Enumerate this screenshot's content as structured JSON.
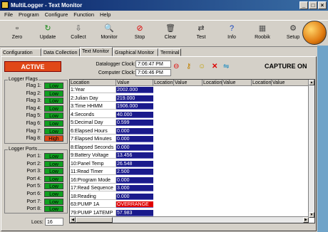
{
  "window": {
    "title": "MultiLogger - Text Monitor"
  },
  "menu": [
    "File",
    "Program",
    "Configure",
    "Function",
    "Help"
  ],
  "toolbar": [
    {
      "label": "Zero",
      "icon": "zero-icon",
      "glyph": "▫",
      "color": "#000"
    },
    {
      "label": "Update",
      "icon": "update-icon",
      "glyph": "↻",
      "color": "#1a8a1a"
    },
    {
      "label": "Collect",
      "icon": "collect-icon",
      "glyph": "⇩",
      "color": "#555"
    },
    {
      "label": "Monitor",
      "icon": "monitor-icon",
      "glyph": "🔍",
      "color": "#333"
    },
    {
      "label": "Stop",
      "icon": "stop-icon",
      "glyph": "⊘",
      "color": "#d00"
    },
    {
      "label": "Clear",
      "icon": "clear-icon",
      "glyph": "🗑",
      "color": "#333"
    },
    {
      "label": "Test",
      "icon": "test-icon",
      "glyph": "⇄",
      "color": "#333"
    },
    {
      "label": "Info",
      "icon": "info-icon",
      "glyph": "?",
      "color": "#1040c0"
    },
    {
      "label": "Roobik",
      "icon": "roobik-icon",
      "glyph": "▦",
      "color": "#555"
    },
    {
      "label": "Setup",
      "icon": "setup-icon",
      "glyph": "⚙",
      "color": "#333"
    }
  ],
  "tabs": [
    "Configuration",
    "Data Collection",
    "Text Monitor",
    "Graphical Monitor",
    "Terminal"
  ],
  "active_tab": "Text Monitor",
  "status": {
    "active": "ACTIVE",
    "capture": "CAPTURE ON"
  },
  "clocks": {
    "datalogger_label": "Datalogger Clock:",
    "datalogger_value": "7:06:47 PM",
    "computer_label": "Computer Clock:",
    "computer_value": "7:06:46 PM"
  },
  "logger_flags": {
    "title": "Logger Flags",
    "items": [
      {
        "label": "Flag 1:",
        "state": "Low"
      },
      {
        "label": "Flag 2:",
        "state": "Low"
      },
      {
        "label": "Flag 3:",
        "state": "Low"
      },
      {
        "label": "Flag 4:",
        "state": "Low"
      },
      {
        "label": "Flag 5:",
        "state": "Low"
      },
      {
        "label": "Flag 6:",
        "state": "Low"
      },
      {
        "label": "Flag 7:",
        "state": "Low"
      },
      {
        "label": "Flag 8:",
        "state": "High"
      }
    ]
  },
  "logger_ports": {
    "title": "Logger Ports",
    "items": [
      {
        "label": "Port 1:",
        "state": "Low"
      },
      {
        "label": "Port 2:",
        "state": "Low"
      },
      {
        "label": "Port 3:",
        "state": "Low"
      },
      {
        "label": "Port 4:",
        "state": "Low"
      },
      {
        "label": "Port 5:",
        "state": "Low"
      },
      {
        "label": "Port 6:",
        "state": "Low"
      },
      {
        "label": "Port 7:",
        "state": "Low"
      },
      {
        "label": "Port 8:",
        "state": "Low"
      }
    ]
  },
  "locs": {
    "label": "Locs:",
    "value": "16"
  },
  "grid": {
    "headers": [
      "Location",
      "Value",
      "Location",
      "Value",
      "Location",
      "Value",
      "Location",
      "Value"
    ],
    "rows": [
      {
        "location": "1:Year",
        "value": "2002.000"
      },
      {
        "location": "2:Julian Day",
        "value": "219.000"
      },
      {
        "location": "3:Time HHMM",
        "value": "1906.000"
      },
      {
        "location": "4:Seconds",
        "value": "40.000"
      },
      {
        "location": "5:Decimal Day",
        "value": "0.599"
      },
      {
        "location": "6:Elapsed Hours",
        "value": "0.000"
      },
      {
        "location": "7:Elapsed Minutes",
        "value": "0.000"
      },
      {
        "location": "8:Elapsed Seconds",
        "value": "0.000"
      },
      {
        "location": "9:Battery Voltage",
        "value": "13.456"
      },
      {
        "location": "10:Panel Temp",
        "value": "26.548"
      },
      {
        "location": "11:Read Timer",
        "value": "2.500"
      },
      {
        "location": "16:Program Mode",
        "value": "0.000"
      },
      {
        "location": "17:Read Sequence",
        "value": "3.000"
      },
      {
        "location": "18:Reading",
        "value": "0.000"
      },
      {
        "location": "63:PUMP 1A",
        "value": "OVERRANGE"
      },
      {
        "location": "79:PUMP 1ATEMP",
        "value": "57.983"
      }
    ]
  },
  "colors": {
    "active": "#e04818",
    "low": "#10a020",
    "high": "#e04818",
    "value_bg": "#1a1a8c",
    "alert": "#e00000"
  }
}
